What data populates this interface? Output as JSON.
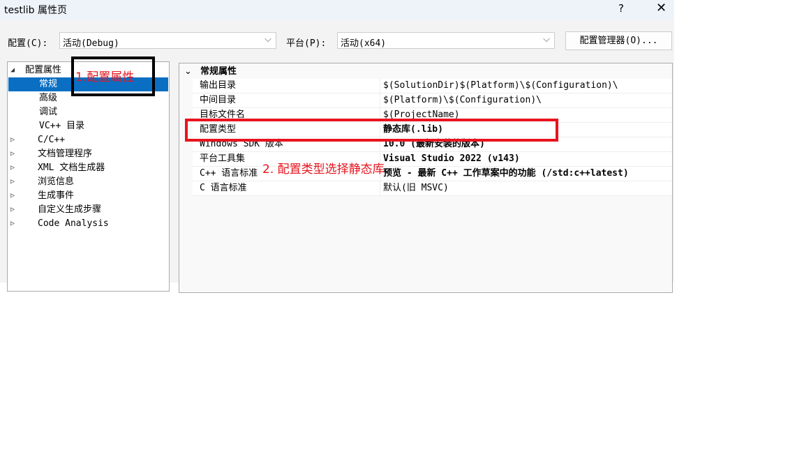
{
  "window": {
    "title": "testlib 属性页",
    "help": "?",
    "close": "✕"
  },
  "toolbar": {
    "config_label": "配置(C):",
    "config_value": "活动(Debug)",
    "platform_label": "平台(P):",
    "platform_value": "活动(x64)",
    "manager_button": "配置管理器(O)..."
  },
  "tree": [
    {
      "label": "配置属性",
      "arrow": "◢",
      "indent": 0
    },
    {
      "label": "常规",
      "arrow": "",
      "indent": 2,
      "selected": true
    },
    {
      "label": "高级",
      "arrow": "",
      "indent": 2
    },
    {
      "label": "调试",
      "arrow": "",
      "indent": 2
    },
    {
      "label": "VC++ 目录",
      "arrow": "",
      "indent": 2
    },
    {
      "label": "C/C++",
      "arrow": "▷",
      "indent": 1
    },
    {
      "label": "文档管理程序",
      "arrow": "▷",
      "indent": 1
    },
    {
      "label": "XML 文档生成器",
      "arrow": "▷",
      "indent": 1
    },
    {
      "label": "浏览信息",
      "arrow": "▷",
      "indent": 1
    },
    {
      "label": "生成事件",
      "arrow": "▷",
      "indent": 1
    },
    {
      "label": "自定义生成步骤",
      "arrow": "▷",
      "indent": 1
    },
    {
      "label": "Code Analysis",
      "arrow": "▷",
      "indent": 1
    }
  ],
  "grid": {
    "section": "常规属性",
    "rows": [
      {
        "name": "输出目录",
        "value": "$(SolutionDir)$(Platform)\\$(Configuration)\\",
        "bold": false
      },
      {
        "name": "中间目录",
        "value": "$(Platform)\\$(Configuration)\\",
        "bold": false
      },
      {
        "name": "目标文件名",
        "value": "$(ProjectName)",
        "bold": false
      },
      {
        "name": "配置类型",
        "value": "静态库(.lib)",
        "bold": true
      },
      {
        "name": "Windows SDK 版本",
        "value": "10.0 (最新安装的版本)",
        "bold": true
      },
      {
        "name": "平台工具集",
        "value": "Visual Studio 2022 (v143)",
        "bold": true
      },
      {
        "name": "C++ 语言标准",
        "value": "预览 - 最新 C++ 工作草案中的功能 (/std:c++latest)",
        "bold": true
      },
      {
        "name": "C 语言标准",
        "value": "默认(旧 MSVC)",
        "bold": false
      }
    ]
  },
  "annotations": {
    "step1": "1.配置属性",
    "step2": "2. 配置类型选择静态库",
    "color": "#e8141e"
  },
  "colors": {
    "selection": "#0a6fc2"
  }
}
